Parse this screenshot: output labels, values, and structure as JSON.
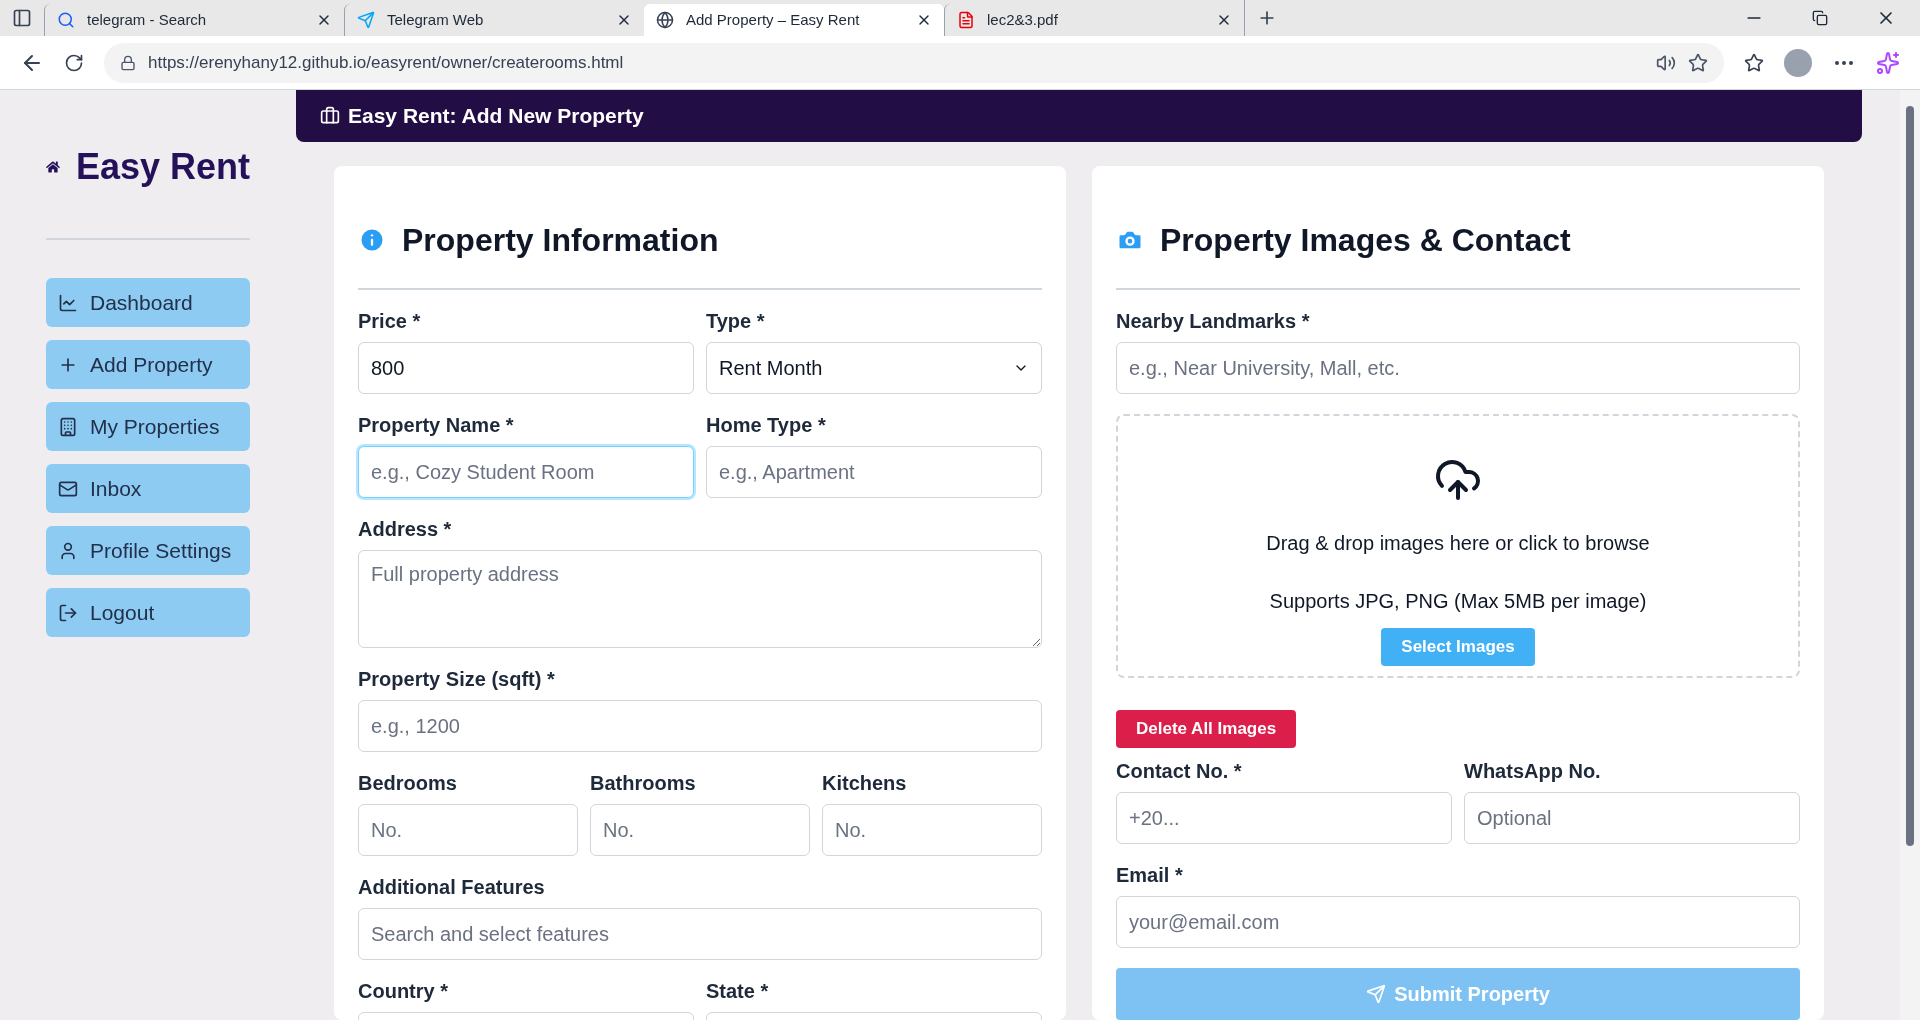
{
  "browser": {
    "tabs": [
      {
        "title": "telegram - Search",
        "kind": "search",
        "selected": false
      },
      {
        "title": "Telegram Web",
        "kind": "telegram",
        "selected": false
      },
      {
        "title": "Add Property – Easy Rent",
        "kind": "web",
        "selected": true
      },
      {
        "title": "lec2&3.pdf",
        "kind": "pdf",
        "selected": false
      }
    ],
    "url": "https://erenyhany12.github.io/easyrent/owner/createrooms.html"
  },
  "sidebar": {
    "brand": "Easy Rent",
    "items": [
      {
        "label": "Dashboard",
        "kind": "chart"
      },
      {
        "label": "Add Property",
        "kind": "plus"
      },
      {
        "label": "My Properties",
        "kind": "building"
      },
      {
        "label": "Inbox",
        "kind": "mail"
      },
      {
        "label": "Profile Settings",
        "kind": "user"
      },
      {
        "label": "Logout",
        "kind": "logout"
      }
    ]
  },
  "header": {
    "title": "Easy Rent: Add New Property"
  },
  "property_info": {
    "title": "Property Information",
    "rows": [
      [
        {
          "label": "Price *",
          "kind": "input",
          "value": "800",
          "focused": false
        },
        {
          "label": "Type *",
          "kind": "select",
          "value": "Rent Month",
          "focused": false
        }
      ],
      [
        {
          "label": "Property Name *",
          "kind": "input",
          "placeholder": "e.g., Cozy Student Room",
          "focused": true
        },
        {
          "label": "Home Type *",
          "kind": "input",
          "placeholder": "e.g., Apartment",
          "focused": false
        }
      ],
      [
        {
          "label": "Address *",
          "kind": "textarea",
          "placeholder": "Full property address",
          "focused": false
        }
      ],
      [
        {
          "label": "Property Size (sqft) *",
          "kind": "input",
          "placeholder": "e.g., 1200",
          "focused": false
        }
      ],
      [
        {
          "label": "Bedrooms",
          "kind": "input",
          "placeholder": "No.",
          "focused": false
        },
        {
          "label": "Bathrooms",
          "kind": "input",
          "placeholder": "No.",
          "focused": false
        },
        {
          "label": "Kitchens",
          "kind": "input",
          "placeholder": "No.",
          "focused": false
        }
      ],
      [
        {
          "label": "Additional Features",
          "kind": "input",
          "placeholder": "Search and select features",
          "focused": false
        }
      ],
      [
        {
          "label": "Country *",
          "kind": "input",
          "focused": false
        },
        {
          "label": "State *",
          "kind": "input",
          "focused": false
        }
      ]
    ]
  },
  "images_contact": {
    "title": "Property Images & Contact",
    "landmarks": {
      "label": "Nearby Landmarks *",
      "placeholder": "e.g., Near University, Mall, etc."
    },
    "dropzone": {
      "text": "Drag & drop images here or click to browse",
      "note": "Supports JPG, PNG (Max 5MB per image)",
      "button": "Select Images"
    },
    "delete_button": "Delete All Images",
    "contact": [
      {
        "label": "Contact No. *",
        "placeholder": "+20..."
      },
      {
        "label": "WhatsApp No.",
        "placeholder": "Optional"
      }
    ],
    "email": {
      "label": "Email *",
      "placeholder": "your@email.com"
    },
    "submit_button": "Submit Property"
  }
}
